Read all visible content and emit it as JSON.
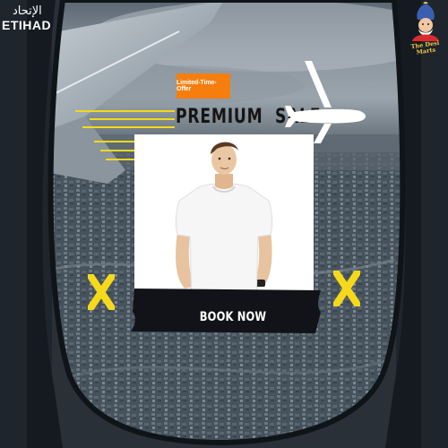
{
  "brand": {
    "arabic": "الإتحاد",
    "name": "ETIHAD"
  },
  "desi_logo": {
    "text": "The Desi Marts"
  },
  "offer_badge": {
    "label": "Limited-Time-Offer"
  },
  "headline": {
    "text": "PREMIUM  SALE"
  },
  "product": {
    "image_name": "white-t-shirt-model"
  },
  "cta": {
    "label": "BOOK NOW"
  },
  "colors": {
    "badge": "#f57e0f",
    "accent_yellow": "#f5d91a",
    "cta_bar": "#111318",
    "text_dark": "#151515",
    "white": "#ffffff"
  }
}
